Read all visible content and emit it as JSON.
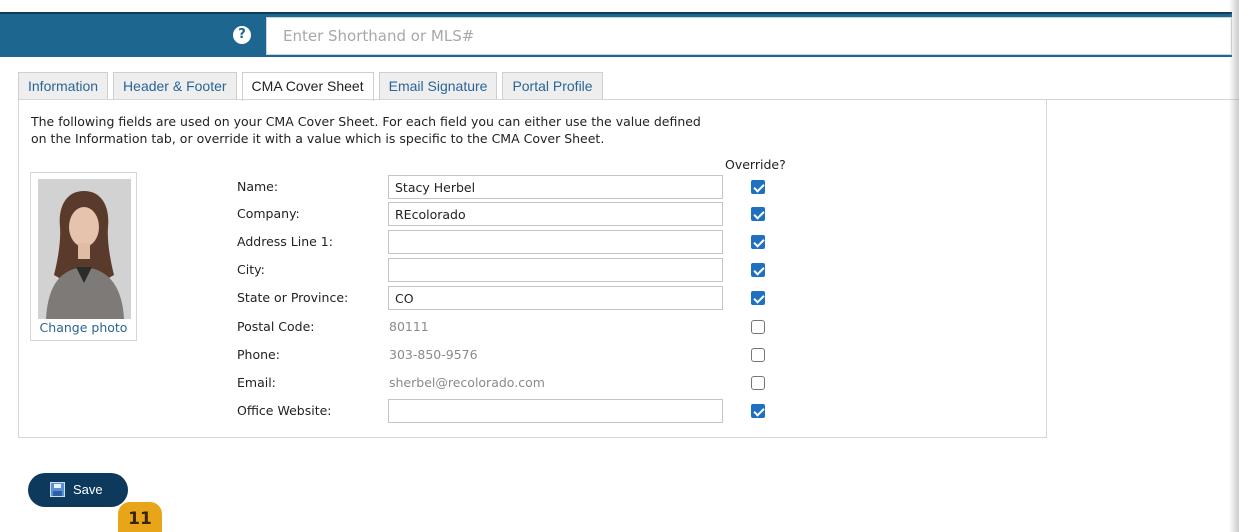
{
  "search": {
    "placeholder": "Enter Shorthand or MLS#",
    "help_icon": "?"
  },
  "tabs": [
    {
      "label": "Information",
      "active": false
    },
    {
      "label": "Header & Footer",
      "active": false
    },
    {
      "label": "CMA Cover Sheet",
      "active": true
    },
    {
      "label": "Email Signature",
      "active": false
    },
    {
      "label": "Portal Profile",
      "active": false
    }
  ],
  "panel": {
    "intro_line1": "The following fields are used on your CMA Cover Sheet. For each field you can either use the value defined",
    "intro_line2": "on the Information tab, or override it with a value which is specific to the CMA Cover Sheet.",
    "override_header": "Override?",
    "change_photo": "Change photo",
    "fields": [
      {
        "label": "Name:",
        "value": "Stacy Herbel",
        "editable": true,
        "override": true
      },
      {
        "label": "Company:",
        "value": "REcolorado",
        "editable": true,
        "override": true
      },
      {
        "label": "Address Line 1:",
        "value": "",
        "editable": true,
        "override": true
      },
      {
        "label": "City:",
        "value": "",
        "editable": true,
        "override": true
      },
      {
        "label": "State or Province:",
        "value": "CO",
        "editable": true,
        "override": true
      },
      {
        "label": "Postal Code:",
        "value": "80111",
        "editable": false,
        "override": false
      },
      {
        "label": "Phone:",
        "value": "303-850-9576",
        "editable": false,
        "override": false
      },
      {
        "label": "Email:",
        "value": "sherbel@recolorado.com",
        "editable": false,
        "override": false
      },
      {
        "label": "Office Website:",
        "value": "",
        "editable": true,
        "override": true
      }
    ]
  },
  "save": {
    "label": "Save"
  },
  "step_badge": "11",
  "colors": {
    "topbar": "#1d6690",
    "save_button": "#0d3a5c",
    "checkbox": "#1f70c1",
    "badge": "#e9a51a"
  }
}
